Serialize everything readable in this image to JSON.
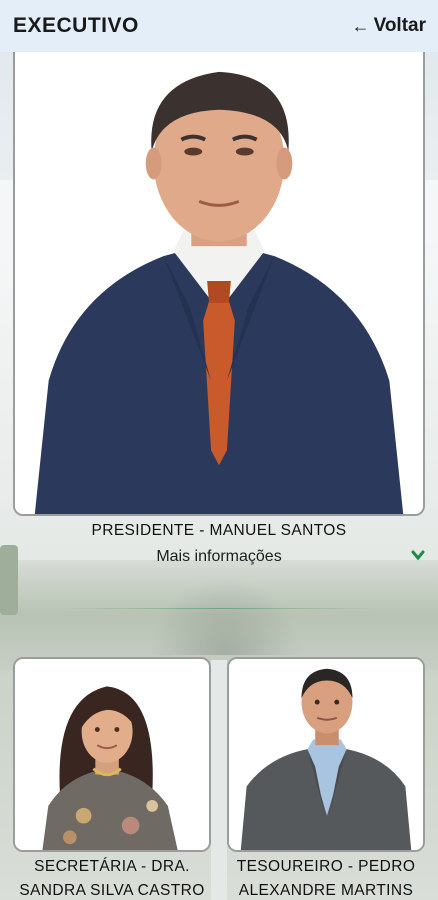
{
  "header": {
    "title": "EXECUTIVO",
    "back_label": "Voltar",
    "back_icon": "arrow-left-icon"
  },
  "members": [
    {
      "role": "PRESIDENTE - MANUEL SANTOS",
      "more_label": "Mais informações",
      "more_icon": "chevron-down-icon"
    },
    {
      "role": "SECRETÁRIA - DRA. SANDRA SILVA CASTRO"
    },
    {
      "role": "TESOUREIRO - PEDRO ALEXANDRE MARTINS"
    }
  ],
  "colors": {
    "header_bg": "#e4eef8",
    "accent_green": "#1e8c46",
    "card_border": "#9c9c9c"
  }
}
